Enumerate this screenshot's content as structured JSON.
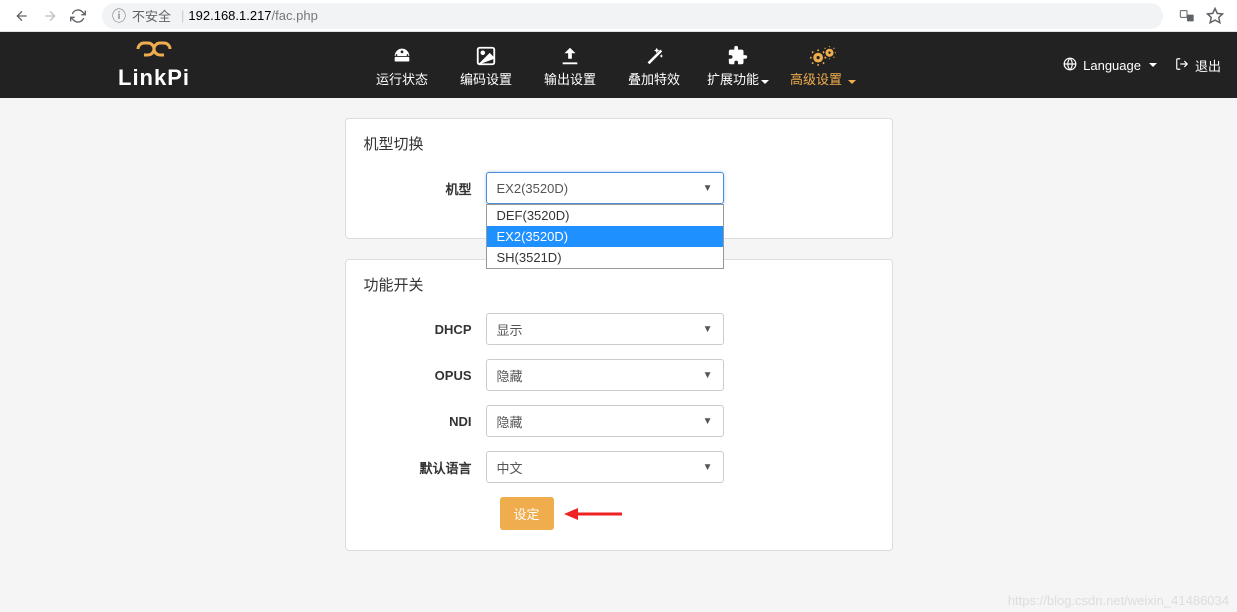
{
  "browser": {
    "security": "不安全",
    "host": "192.168.1.217",
    "path": "/fac.php"
  },
  "nav": {
    "logo_text": "LinkPi",
    "items": [
      {
        "label": "运行状态"
      },
      {
        "label": "编码设置"
      },
      {
        "label": "输出设置"
      },
      {
        "label": "叠加特效"
      },
      {
        "label": "扩展功能"
      },
      {
        "label": "高级设置"
      }
    ],
    "language": "Language",
    "logout": "退出"
  },
  "panel1": {
    "title": "机型切换",
    "label_model": "机型",
    "model_selected": "EX2(3520D)",
    "model_options": [
      "DEF(3520D)",
      "EX2(3520D)",
      "SH(3521D)"
    ]
  },
  "panel2": {
    "title": "功能开关",
    "label_dhcp": "DHCP",
    "dhcp_value": "显示",
    "label_opus": "OPUS",
    "opus_value": "隐藏",
    "label_ndi": "NDI",
    "ndi_value": "隐藏",
    "label_lang": "默认语言",
    "lang_value": "中文",
    "btn_set": "设定"
  },
  "watermark": "https://blog.csdn.net/weixin_41486034"
}
